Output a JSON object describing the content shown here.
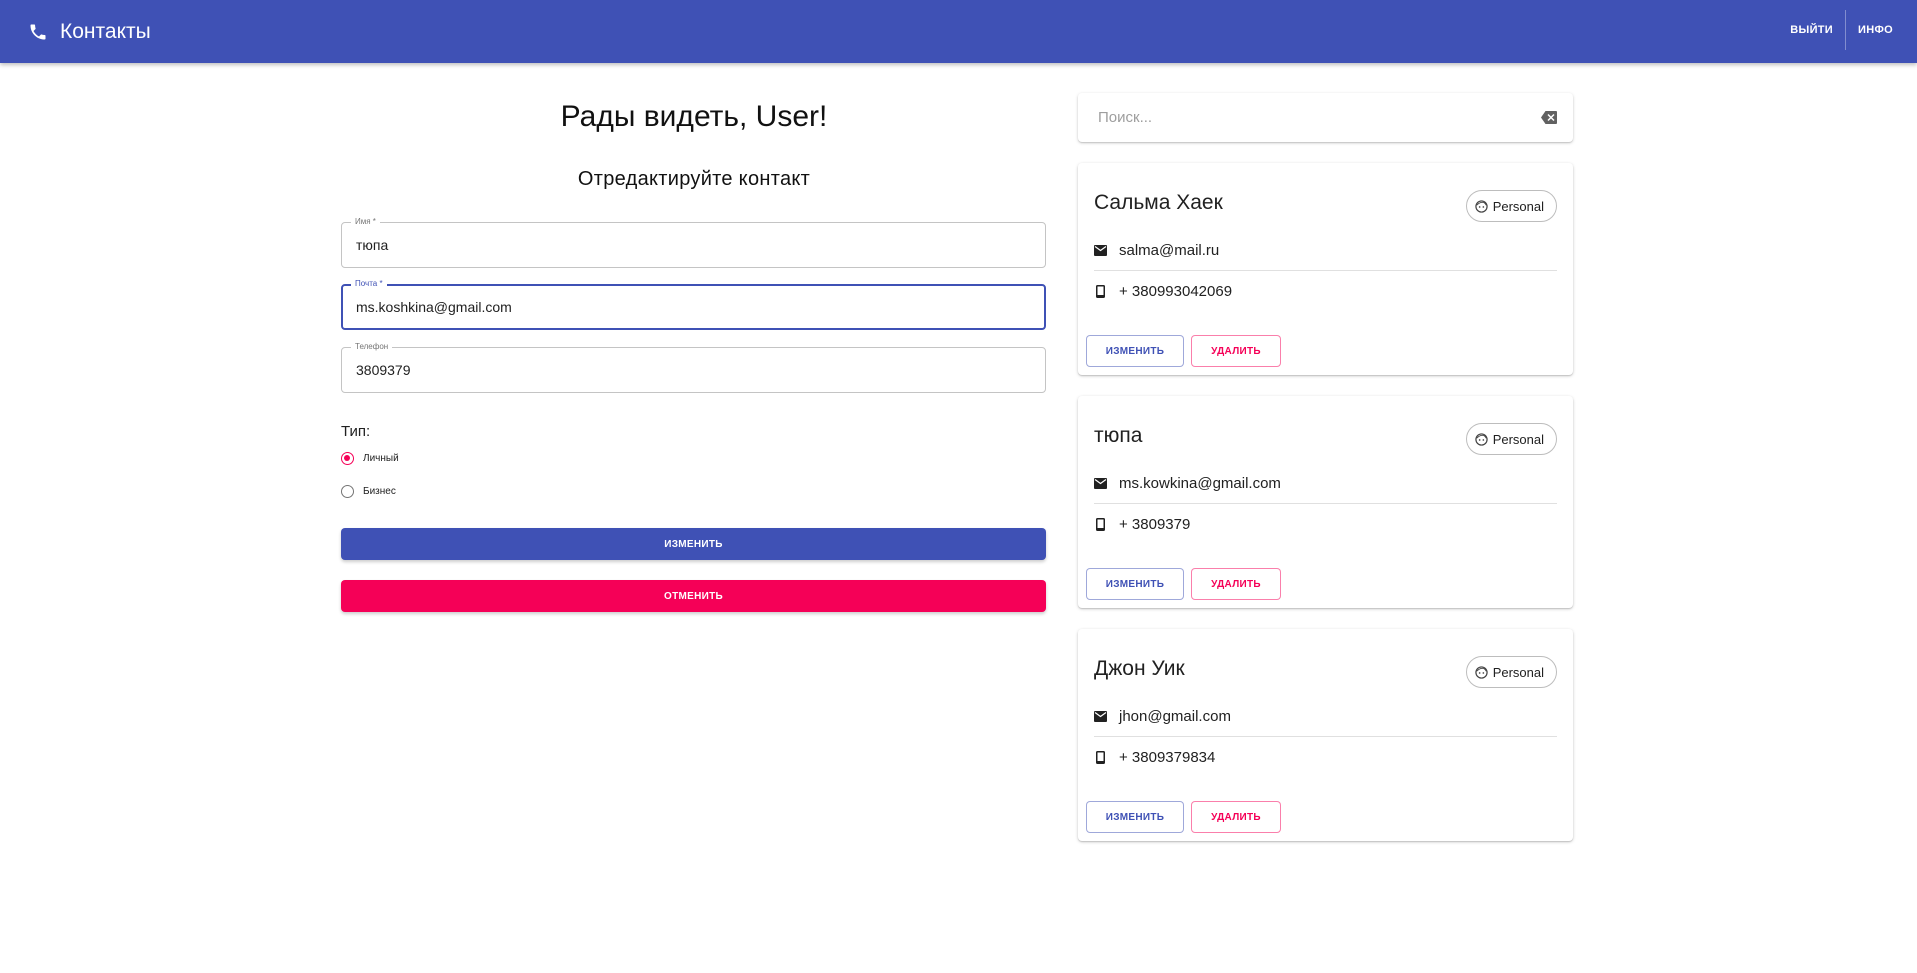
{
  "appbar": {
    "title": "Контакты",
    "icon": "phone-icon",
    "nav": [
      {
        "label": "ВЫЙТИ"
      },
      {
        "label": "ИНФО"
      }
    ]
  },
  "form": {
    "greeting": "Рады видеть, User!",
    "subtitle": "Отредактируйте контакт",
    "fields": {
      "name": {
        "label": "Имя *",
        "value": "тюпа"
      },
      "email": {
        "label": "Почта *",
        "value": "ms.koshkina@gmail.com"
      },
      "phone": {
        "label": "Телефон",
        "value": "3809379"
      }
    },
    "type_label": "Тип:",
    "type_options": [
      {
        "label": "Личный",
        "checked": true
      },
      {
        "label": "Бизнес",
        "checked": false
      }
    ],
    "submit_label": "ИЗМЕНИТЬ",
    "cancel_label": "ОТМЕНИТЬ"
  },
  "search": {
    "placeholder": "Поиск...",
    "value": "",
    "clear_icon": "backspace-icon"
  },
  "contacts": [
    {
      "name": "Сальма Хаек",
      "type": "Personal",
      "email": "salma@mail.ru",
      "phone": "+ 380993042069",
      "edit_label": "ИЗМЕНИТЬ",
      "delete_label": "УДАЛИТЬ"
    },
    {
      "name": "тюпа",
      "type": "Personal",
      "email": "ms.kowkina@gmail.com",
      "phone": "+ 3809379",
      "edit_label": "ИЗМЕНИТЬ",
      "delete_label": "УДАЛИТЬ"
    },
    {
      "name": "Джон Уик",
      "type": "Personal",
      "email": "jhon@gmail.com",
      "phone": "+ 3809379834",
      "edit_label": "ИЗМЕНИТЬ",
      "delete_label": "УДАЛИТЬ"
    }
  ],
  "colors": {
    "primary": "#3f51b5",
    "secondary": "#f50057",
    "text": "#212121"
  }
}
